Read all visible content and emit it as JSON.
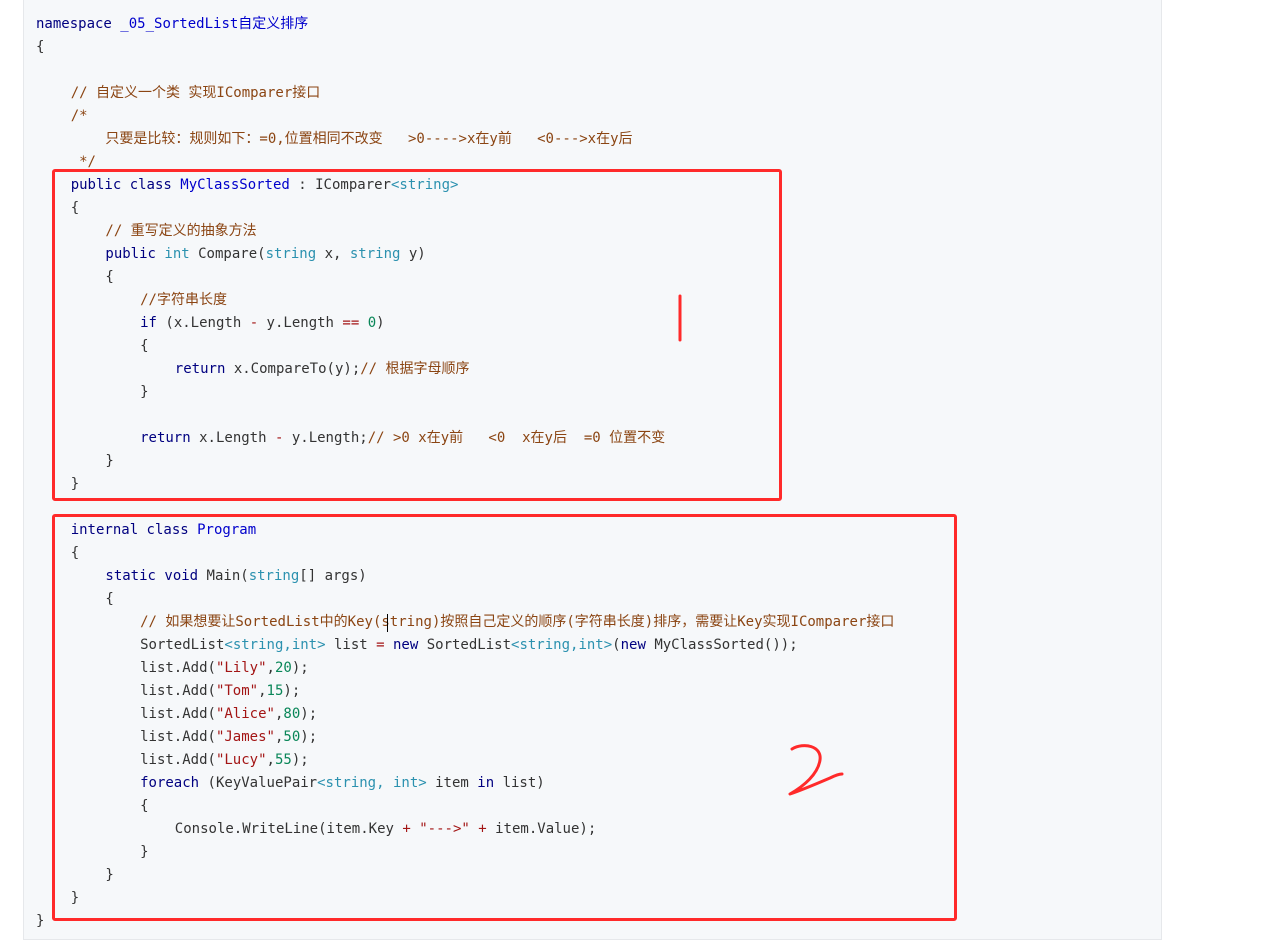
{
  "code": {
    "lines": [
      {
        "indent": 0,
        "parts": [
          {
            "c": "kw2",
            "t": "namespace "
          },
          {
            "c": "cls",
            "t": "_05_SortedList自定义排序"
          }
        ]
      },
      {
        "indent": 0,
        "parts": [
          {
            "c": "op",
            "t": "{"
          }
        ]
      },
      {
        "indent": 0,
        "parts": []
      },
      {
        "indent": 1,
        "parts": [
          {
            "c": "cmt",
            "t": "// 自定义一个类 实现IComparer接口"
          }
        ]
      },
      {
        "indent": 1,
        "parts": [
          {
            "c": "cmt",
            "t": "/*"
          }
        ]
      },
      {
        "indent": 2,
        "parts": [
          {
            "c": "cmt",
            "t": "只要是比较：规则如下：=0,位置相同不改变   >0---->x在y前   <0--->x在y后"
          }
        ]
      },
      {
        "indent": 1,
        "parts": [
          {
            "c": "cmt",
            "t": " */"
          }
        ]
      },
      {
        "indent": 1,
        "parts": [
          {
            "c": "kw2",
            "t": "public class "
          },
          {
            "c": "cls",
            "t": "MyClassSorted"
          },
          {
            "c": "op",
            "t": " : IComparer"
          },
          {
            "c": "type",
            "t": "<string>"
          }
        ]
      },
      {
        "indent": 1,
        "parts": [
          {
            "c": "op",
            "t": "{"
          }
        ]
      },
      {
        "indent": 2,
        "parts": [
          {
            "c": "cmt",
            "t": "// 重写定义的抽象方法"
          }
        ]
      },
      {
        "indent": 2,
        "parts": [
          {
            "c": "kw2",
            "t": "public "
          },
          {
            "c": "type",
            "t": "int "
          },
          {
            "c": "op",
            "t": "Compare("
          },
          {
            "c": "type",
            "t": "string"
          },
          {
            "c": "op",
            "t": " x, "
          },
          {
            "c": "type",
            "t": "string"
          },
          {
            "c": "op",
            "t": " y)"
          }
        ]
      },
      {
        "indent": 2,
        "parts": [
          {
            "c": "op",
            "t": "{"
          }
        ]
      },
      {
        "indent": 3,
        "parts": [
          {
            "c": "cmt",
            "t": "//字符串长度"
          }
        ]
      },
      {
        "indent": 3,
        "parts": [
          {
            "c": "kw2",
            "t": "if "
          },
          {
            "c": "op",
            "t": "(x.Length "
          },
          {
            "c": "str",
            "t": "-"
          },
          {
            "c": "op",
            "t": " y.Length "
          },
          {
            "c": "str",
            "t": "=="
          },
          {
            "c": "op",
            "t": " "
          },
          {
            "c": "num",
            "t": "0"
          },
          {
            "c": "op",
            "t": ")"
          }
        ]
      },
      {
        "indent": 3,
        "parts": [
          {
            "c": "op",
            "t": "{"
          }
        ]
      },
      {
        "indent": 4,
        "parts": [
          {
            "c": "kw2",
            "t": "return "
          },
          {
            "c": "op",
            "t": "x.CompareTo(y);"
          },
          {
            "c": "cmt",
            "t": "// 根据字母顺序"
          }
        ]
      },
      {
        "indent": 3,
        "parts": [
          {
            "c": "op",
            "t": "}"
          }
        ]
      },
      {
        "indent": 0,
        "parts": []
      },
      {
        "indent": 3,
        "parts": [
          {
            "c": "kw2",
            "t": "return "
          },
          {
            "c": "op",
            "t": "x.Length "
          },
          {
            "c": "str",
            "t": "-"
          },
          {
            "c": "op",
            "t": " y.Length;"
          },
          {
            "c": "cmt",
            "t": "// >0 x在y前   <0  x在y后  =0 位置不变"
          }
        ]
      },
      {
        "indent": 2,
        "parts": [
          {
            "c": "op",
            "t": "}"
          }
        ]
      },
      {
        "indent": 1,
        "parts": [
          {
            "c": "op",
            "t": "}"
          }
        ]
      },
      {
        "indent": 0,
        "parts": []
      },
      {
        "indent": 1,
        "parts": [
          {
            "c": "kw2",
            "t": "internal class "
          },
          {
            "c": "cls",
            "t": "Program"
          }
        ]
      },
      {
        "indent": 1,
        "parts": [
          {
            "c": "op",
            "t": "{"
          }
        ]
      },
      {
        "indent": 2,
        "parts": [
          {
            "c": "kw2",
            "t": "static void "
          },
          {
            "c": "op",
            "t": "Main("
          },
          {
            "c": "type",
            "t": "string"
          },
          {
            "c": "op",
            "t": "[] args)"
          }
        ]
      },
      {
        "indent": 2,
        "parts": [
          {
            "c": "op",
            "t": "{"
          }
        ]
      },
      {
        "indent": 3,
        "parts": [
          {
            "c": "cmt",
            "t": "// 如果想要让SortedList中的Key(string)按照自己定义的顺序(字符串长度)排序，需要让Key实现IComparer接口"
          }
        ]
      },
      {
        "indent": 3,
        "parts": [
          {
            "c": "op",
            "t": "SortedList"
          },
          {
            "c": "type",
            "t": "<string,int>"
          },
          {
            "c": "op",
            "t": " list "
          },
          {
            "c": "str",
            "t": "="
          },
          {
            "c": "op",
            "t": " "
          },
          {
            "c": "kw2",
            "t": "new "
          },
          {
            "c": "op",
            "t": "SortedList"
          },
          {
            "c": "type",
            "t": "<string,int>"
          },
          {
            "c": "op",
            "t": "("
          },
          {
            "c": "kw2",
            "t": "new "
          },
          {
            "c": "op",
            "t": "MyClassSorted());"
          }
        ]
      },
      {
        "indent": 3,
        "parts": [
          {
            "c": "op",
            "t": "list.Add("
          },
          {
            "c": "str",
            "t": "\"Lily\""
          },
          {
            "c": "op",
            "t": ","
          },
          {
            "c": "num",
            "t": "20"
          },
          {
            "c": "op",
            "t": ");"
          }
        ]
      },
      {
        "indent": 3,
        "parts": [
          {
            "c": "op",
            "t": "list.Add("
          },
          {
            "c": "str",
            "t": "\"Tom\""
          },
          {
            "c": "op",
            "t": ","
          },
          {
            "c": "num",
            "t": "15"
          },
          {
            "c": "op",
            "t": ");"
          }
        ]
      },
      {
        "indent": 3,
        "parts": [
          {
            "c": "op",
            "t": "list.Add("
          },
          {
            "c": "str",
            "t": "\"Alice\""
          },
          {
            "c": "op",
            "t": ","
          },
          {
            "c": "num",
            "t": "80"
          },
          {
            "c": "op",
            "t": ");"
          }
        ]
      },
      {
        "indent": 3,
        "parts": [
          {
            "c": "op",
            "t": "list.Add("
          },
          {
            "c": "str",
            "t": "\"James\""
          },
          {
            "c": "op",
            "t": ","
          },
          {
            "c": "num",
            "t": "50"
          },
          {
            "c": "op",
            "t": ");"
          }
        ]
      },
      {
        "indent": 3,
        "parts": [
          {
            "c": "op",
            "t": "list.Add("
          },
          {
            "c": "str",
            "t": "\"Lucy\""
          },
          {
            "c": "op",
            "t": ","
          },
          {
            "c": "num",
            "t": "55"
          },
          {
            "c": "op",
            "t": ");"
          }
        ]
      },
      {
        "indent": 3,
        "parts": [
          {
            "c": "kw2",
            "t": "foreach "
          },
          {
            "c": "op",
            "t": "(KeyValuePair"
          },
          {
            "c": "type",
            "t": "<string, int>"
          },
          {
            "c": "op",
            "t": " item "
          },
          {
            "c": "kw2",
            "t": "in "
          },
          {
            "c": "op",
            "t": "list)"
          }
        ]
      },
      {
        "indent": 3,
        "parts": [
          {
            "c": "op",
            "t": "{"
          }
        ]
      },
      {
        "indent": 4,
        "parts": [
          {
            "c": "op",
            "t": "Console.WriteLine(item.Key "
          },
          {
            "c": "str",
            "t": "+"
          },
          {
            "c": "op",
            "t": " "
          },
          {
            "c": "str",
            "t": "\"--->\""
          },
          {
            "c": "op",
            "t": " "
          },
          {
            "c": "str",
            "t": "+"
          },
          {
            "c": "op",
            "t": " item.Value);"
          }
        ]
      },
      {
        "indent": 3,
        "parts": [
          {
            "c": "op",
            "t": "}"
          }
        ]
      },
      {
        "indent": 2,
        "parts": [
          {
            "c": "op",
            "t": "}"
          }
        ]
      },
      {
        "indent": 1,
        "parts": [
          {
            "c": "op",
            "t": "}"
          }
        ]
      },
      {
        "indent": 0,
        "parts": [
          {
            "c": "op",
            "t": "}"
          }
        ]
      }
    ]
  },
  "annotations": {
    "box1_label": "1",
    "box2_label": "2",
    "color": "#ff2a2a"
  }
}
